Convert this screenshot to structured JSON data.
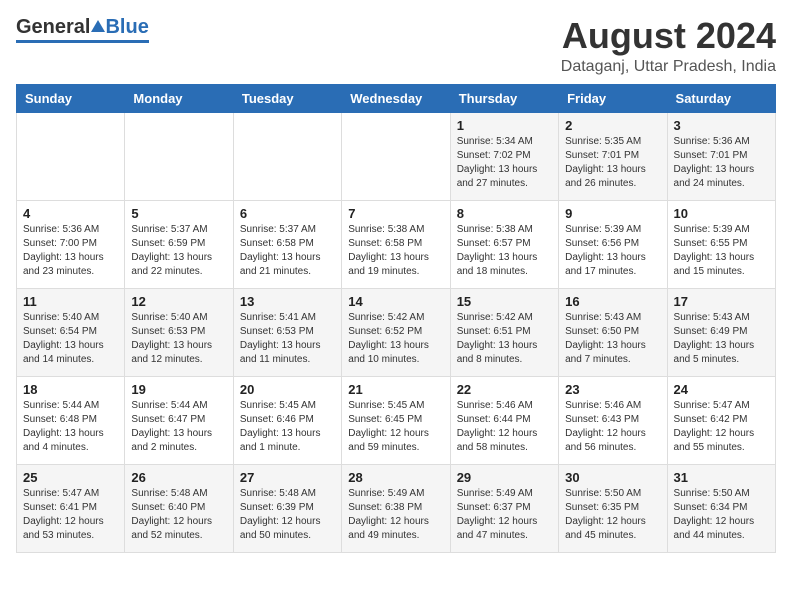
{
  "header": {
    "logo_general": "General",
    "logo_blue": "Blue",
    "month_title": "August 2024",
    "location": "Dataganj, Uttar Pradesh, India"
  },
  "weekdays": [
    "Sunday",
    "Monday",
    "Tuesday",
    "Wednesday",
    "Thursday",
    "Friday",
    "Saturday"
  ],
  "weeks": [
    [
      {
        "day": "",
        "sunrise": "",
        "sunset": "",
        "daylight": ""
      },
      {
        "day": "",
        "sunrise": "",
        "sunset": "",
        "daylight": ""
      },
      {
        "day": "",
        "sunrise": "",
        "sunset": "",
        "daylight": ""
      },
      {
        "day": "",
        "sunrise": "",
        "sunset": "",
        "daylight": ""
      },
      {
        "day": "1",
        "sunrise": "Sunrise: 5:34 AM",
        "sunset": "Sunset: 7:02 PM",
        "daylight": "Daylight: 13 hours and 27 minutes."
      },
      {
        "day": "2",
        "sunrise": "Sunrise: 5:35 AM",
        "sunset": "Sunset: 7:01 PM",
        "daylight": "Daylight: 13 hours and 26 minutes."
      },
      {
        "day": "3",
        "sunrise": "Sunrise: 5:36 AM",
        "sunset": "Sunset: 7:01 PM",
        "daylight": "Daylight: 13 hours and 24 minutes."
      }
    ],
    [
      {
        "day": "4",
        "sunrise": "Sunrise: 5:36 AM",
        "sunset": "Sunset: 7:00 PM",
        "daylight": "Daylight: 13 hours and 23 minutes."
      },
      {
        "day": "5",
        "sunrise": "Sunrise: 5:37 AM",
        "sunset": "Sunset: 6:59 PM",
        "daylight": "Daylight: 13 hours and 22 minutes."
      },
      {
        "day": "6",
        "sunrise": "Sunrise: 5:37 AM",
        "sunset": "Sunset: 6:58 PM",
        "daylight": "Daylight: 13 hours and 21 minutes."
      },
      {
        "day": "7",
        "sunrise": "Sunrise: 5:38 AM",
        "sunset": "Sunset: 6:58 PM",
        "daylight": "Daylight: 13 hours and 19 minutes."
      },
      {
        "day": "8",
        "sunrise": "Sunrise: 5:38 AM",
        "sunset": "Sunset: 6:57 PM",
        "daylight": "Daylight: 13 hours and 18 minutes."
      },
      {
        "day": "9",
        "sunrise": "Sunrise: 5:39 AM",
        "sunset": "Sunset: 6:56 PM",
        "daylight": "Daylight: 13 hours and 17 minutes."
      },
      {
        "day": "10",
        "sunrise": "Sunrise: 5:39 AM",
        "sunset": "Sunset: 6:55 PM",
        "daylight": "Daylight: 13 hours and 15 minutes."
      }
    ],
    [
      {
        "day": "11",
        "sunrise": "Sunrise: 5:40 AM",
        "sunset": "Sunset: 6:54 PM",
        "daylight": "Daylight: 13 hours and 14 minutes."
      },
      {
        "day": "12",
        "sunrise": "Sunrise: 5:40 AM",
        "sunset": "Sunset: 6:53 PM",
        "daylight": "Daylight: 13 hours and 12 minutes."
      },
      {
        "day": "13",
        "sunrise": "Sunrise: 5:41 AM",
        "sunset": "Sunset: 6:53 PM",
        "daylight": "Daylight: 13 hours and 11 minutes."
      },
      {
        "day": "14",
        "sunrise": "Sunrise: 5:42 AM",
        "sunset": "Sunset: 6:52 PM",
        "daylight": "Daylight: 13 hours and 10 minutes."
      },
      {
        "day": "15",
        "sunrise": "Sunrise: 5:42 AM",
        "sunset": "Sunset: 6:51 PM",
        "daylight": "Daylight: 13 hours and 8 minutes."
      },
      {
        "day": "16",
        "sunrise": "Sunrise: 5:43 AM",
        "sunset": "Sunset: 6:50 PM",
        "daylight": "Daylight: 13 hours and 7 minutes."
      },
      {
        "day": "17",
        "sunrise": "Sunrise: 5:43 AM",
        "sunset": "Sunset: 6:49 PM",
        "daylight": "Daylight: 13 hours and 5 minutes."
      }
    ],
    [
      {
        "day": "18",
        "sunrise": "Sunrise: 5:44 AM",
        "sunset": "Sunset: 6:48 PM",
        "daylight": "Daylight: 13 hours and 4 minutes."
      },
      {
        "day": "19",
        "sunrise": "Sunrise: 5:44 AM",
        "sunset": "Sunset: 6:47 PM",
        "daylight": "Daylight: 13 hours and 2 minutes."
      },
      {
        "day": "20",
        "sunrise": "Sunrise: 5:45 AM",
        "sunset": "Sunset: 6:46 PM",
        "daylight": "Daylight: 13 hours and 1 minute."
      },
      {
        "day": "21",
        "sunrise": "Sunrise: 5:45 AM",
        "sunset": "Sunset: 6:45 PM",
        "daylight": "Daylight: 12 hours and 59 minutes."
      },
      {
        "day": "22",
        "sunrise": "Sunrise: 5:46 AM",
        "sunset": "Sunset: 6:44 PM",
        "daylight": "Daylight: 12 hours and 58 minutes."
      },
      {
        "day": "23",
        "sunrise": "Sunrise: 5:46 AM",
        "sunset": "Sunset: 6:43 PM",
        "daylight": "Daylight: 12 hours and 56 minutes."
      },
      {
        "day": "24",
        "sunrise": "Sunrise: 5:47 AM",
        "sunset": "Sunset: 6:42 PM",
        "daylight": "Daylight: 12 hours and 55 minutes."
      }
    ],
    [
      {
        "day": "25",
        "sunrise": "Sunrise: 5:47 AM",
        "sunset": "Sunset: 6:41 PM",
        "daylight": "Daylight: 12 hours and 53 minutes."
      },
      {
        "day": "26",
        "sunrise": "Sunrise: 5:48 AM",
        "sunset": "Sunset: 6:40 PM",
        "daylight": "Daylight: 12 hours and 52 minutes."
      },
      {
        "day": "27",
        "sunrise": "Sunrise: 5:48 AM",
        "sunset": "Sunset: 6:39 PM",
        "daylight": "Daylight: 12 hours and 50 minutes."
      },
      {
        "day": "28",
        "sunrise": "Sunrise: 5:49 AM",
        "sunset": "Sunset: 6:38 PM",
        "daylight": "Daylight: 12 hours and 49 minutes."
      },
      {
        "day": "29",
        "sunrise": "Sunrise: 5:49 AM",
        "sunset": "Sunset: 6:37 PM",
        "daylight": "Daylight: 12 hours and 47 minutes."
      },
      {
        "day": "30",
        "sunrise": "Sunrise: 5:50 AM",
        "sunset": "Sunset: 6:35 PM",
        "daylight": "Daylight: 12 hours and 45 minutes."
      },
      {
        "day": "31",
        "sunrise": "Sunrise: 5:50 AM",
        "sunset": "Sunset: 6:34 PM",
        "daylight": "Daylight: 12 hours and 44 minutes."
      }
    ]
  ]
}
